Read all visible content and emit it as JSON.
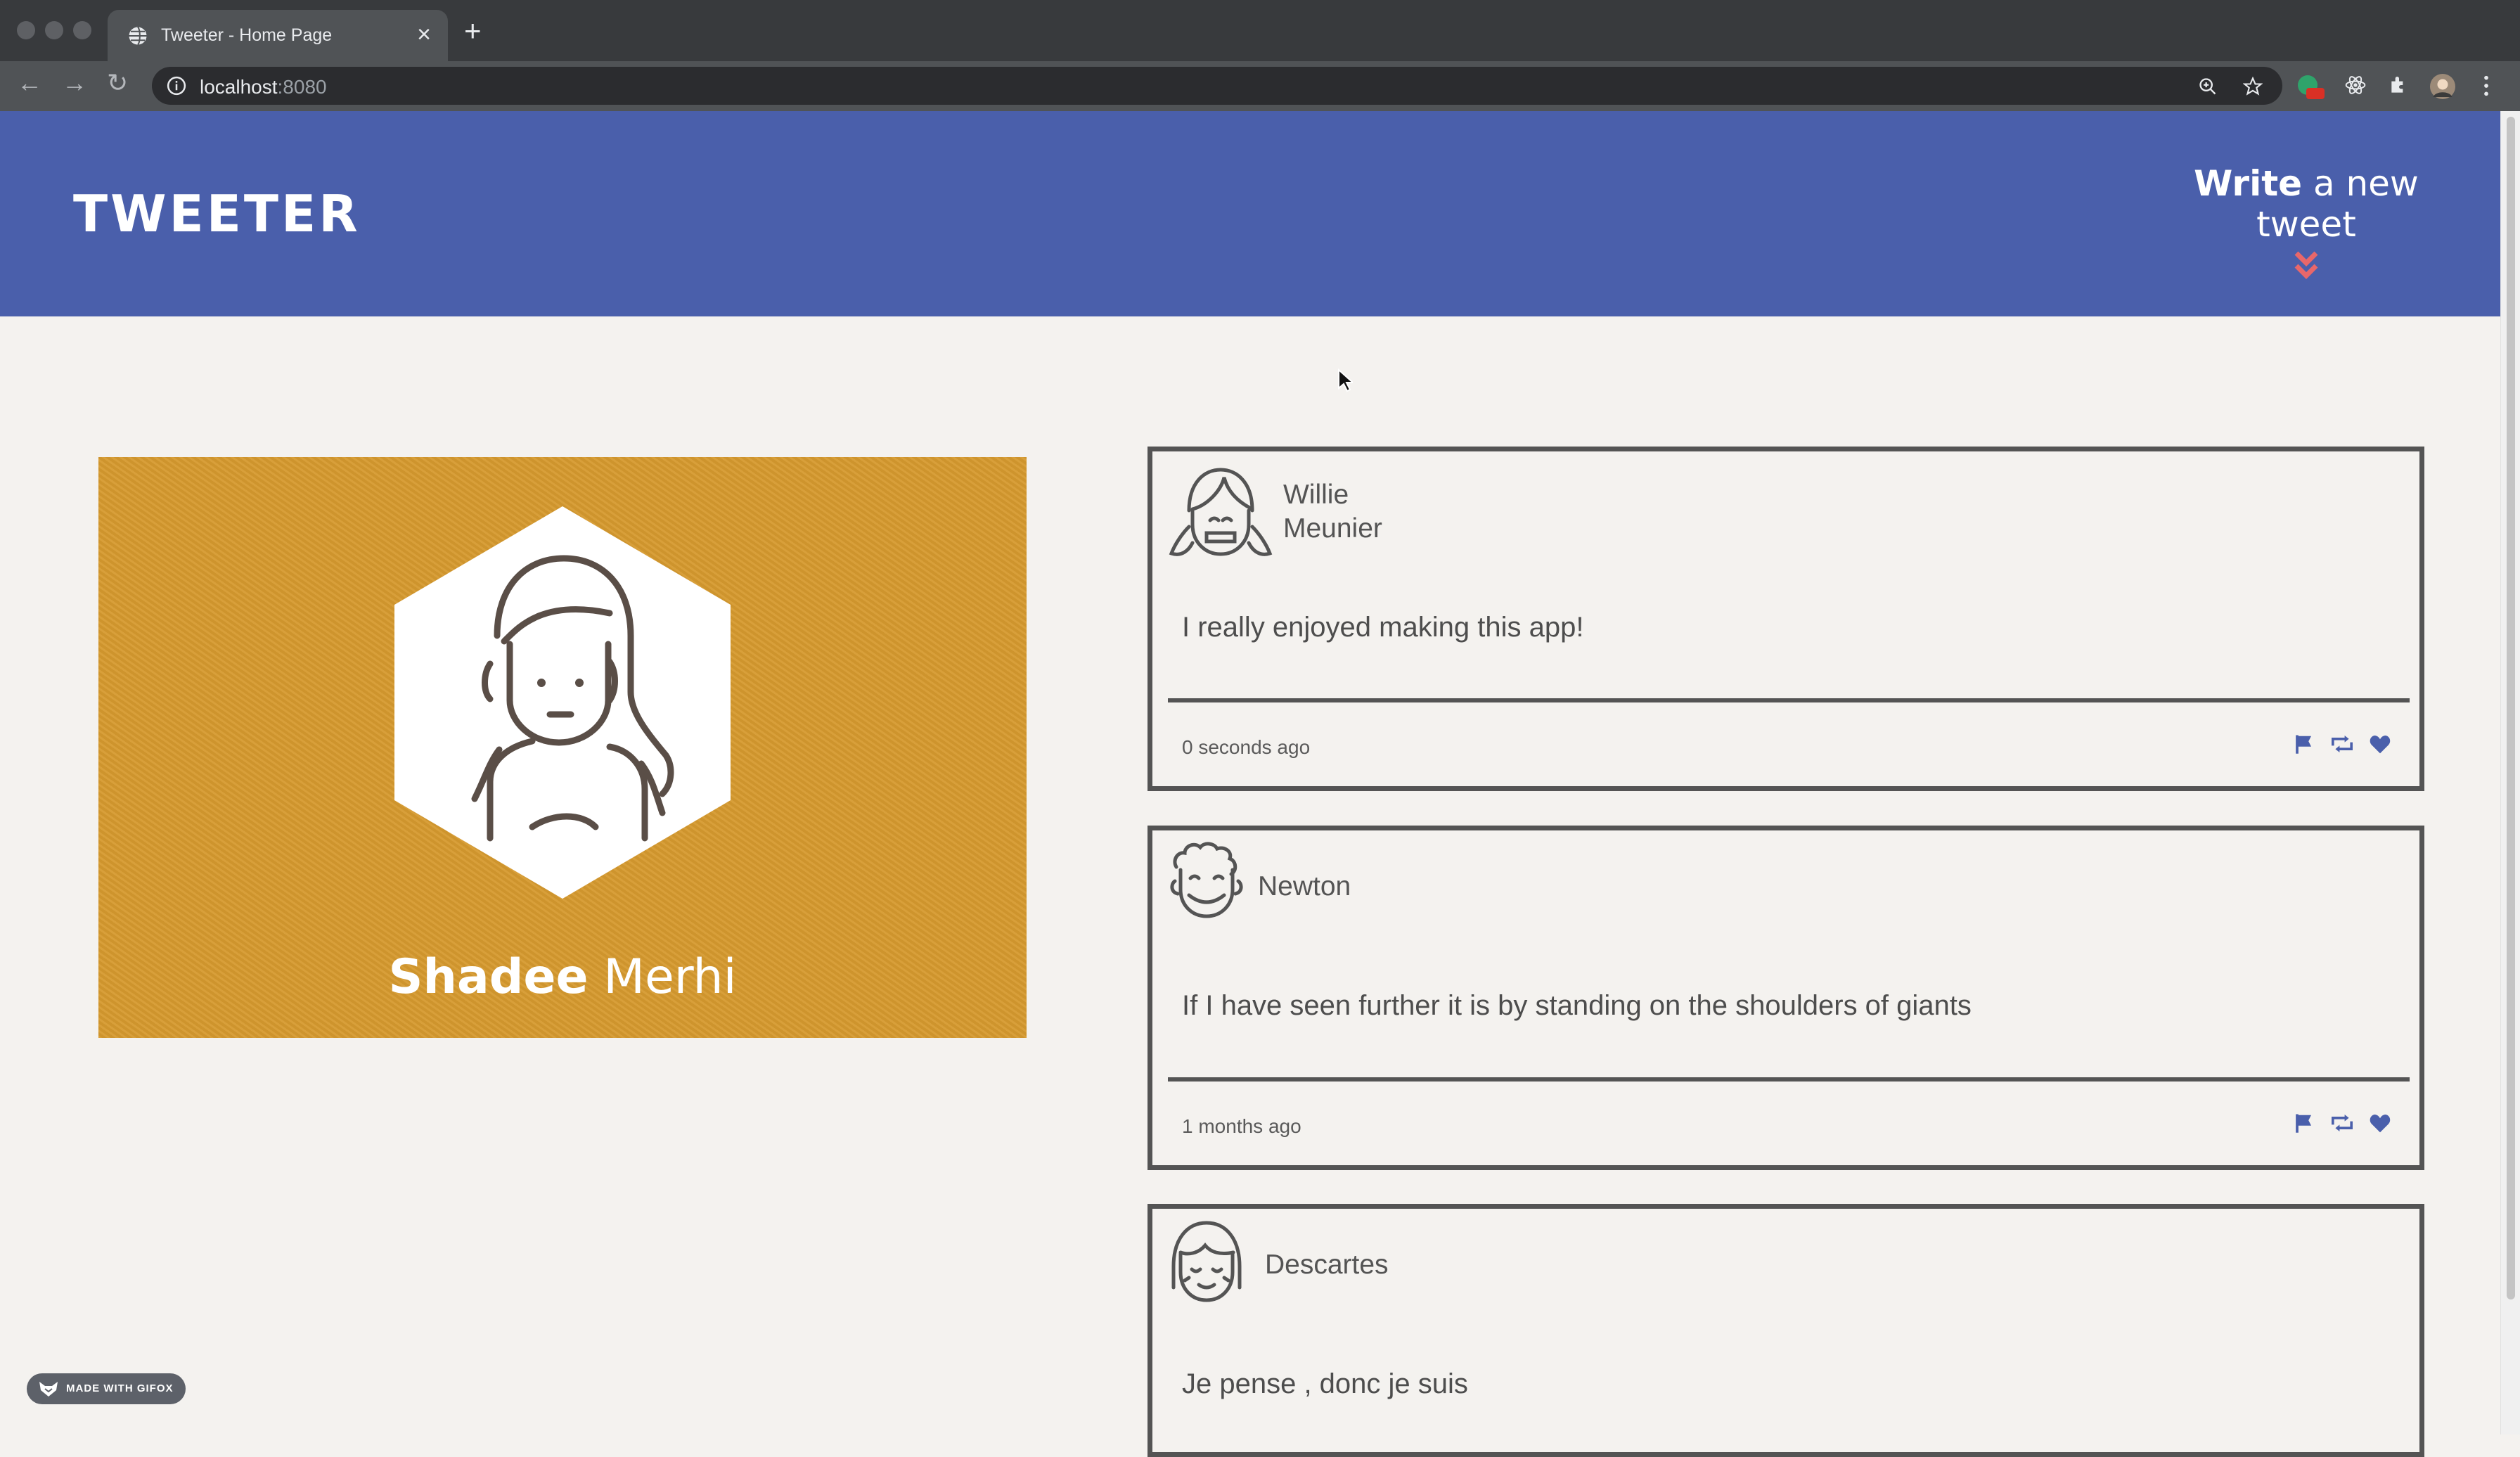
{
  "browser": {
    "tab_title": "Tweeter - Home Page",
    "tab_close": "×",
    "new_tab": "+",
    "url_host": "localhost",
    "url_port": ":8080",
    "back": "←",
    "forward": "→",
    "reload": "↻"
  },
  "header": {
    "brand": "TWEETER",
    "compose_bold": "Write",
    "compose_rest": " a new tweet",
    "accent_color": "#e8676a",
    "background_color": "#4a5fab"
  },
  "profile": {
    "first_name": "Shadee",
    "last_name": " Merhi",
    "card_color": "#d69a2f",
    "avatar_icon": "woman-avatar-icon"
  },
  "tweets": [
    {
      "name_line1": "Willie",
      "name_line2": "Meunier",
      "avatar_icon": "girl-avatar-icon",
      "text": "I really enjoyed making this app!",
      "time": "0 seconds ago"
    },
    {
      "name_line1": "Newton",
      "avatar_icon": "curly-hair-avatar-icon",
      "text": "If I have seen further it is by standing on the shoulders of giants",
      "time": "1 months ago"
    },
    {
      "name_line1": "Descartes",
      "avatar_icon": "bangs-avatar-icon",
      "text": "Je pense , donc je suis"
    }
  ],
  "actions": [
    "flag-icon",
    "retweet-icon",
    "heart-icon"
  ],
  "action_color": "#4a5fab",
  "gifox": "MADE WITH GIFOX"
}
